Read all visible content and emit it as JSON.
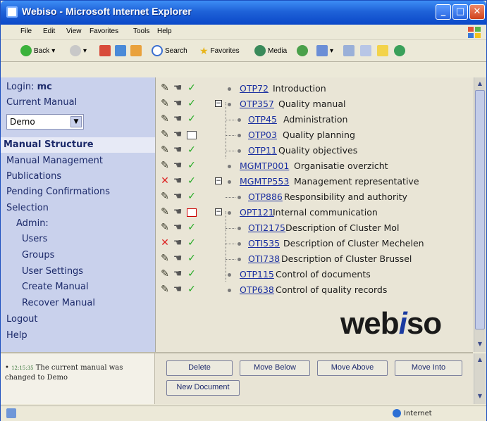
{
  "window": {
    "title": "Webiso - Microsoft Internet Explorer"
  },
  "menu": [
    "File",
    "Edit",
    "View",
    "Favorites",
    "Tools",
    "Help"
  ],
  "toolbar": {
    "back": "Back",
    "search": "Search",
    "favorites": "Favorites",
    "media": "Media"
  },
  "sidebar": {
    "login_label": "Login:",
    "login_user": "mc",
    "current_manual_label": "Current Manual",
    "current_manual_value": "Demo",
    "items": [
      "Manual Structure",
      "Manual Management",
      "Publications",
      "Pending Confirmations",
      "Selection",
      "Admin:",
      "Users",
      "Groups",
      "User Settings",
      "Create Manual",
      "Recover Manual",
      "Logout",
      "Help"
    ]
  },
  "tree": [
    {
      "code": "OTP72",
      "title": "Introduction"
    },
    {
      "code": "OTP357",
      "title": "Quality manual"
    },
    {
      "code": "OTP45",
      "title": "Administration"
    },
    {
      "code": "OTP03",
      "title": "Quality planning"
    },
    {
      "code": "OTP11",
      "title": "Quality objectives"
    },
    {
      "code": "MGMTP001",
      "title": "Organisatie overzicht"
    },
    {
      "code": "MGMTP553",
      "title": "Management representative"
    },
    {
      "code": "OTP886",
      "title": "Responsibility and authority"
    },
    {
      "code": "OPT121",
      "title": "Internal communication"
    },
    {
      "code": "OTI2175",
      "title": "Description of Cluster Mol"
    },
    {
      "code": "OTI535",
      "title": "Description of Cluster Mechelen"
    },
    {
      "code": "OTI738",
      "title": "Description of Cluster Brussel"
    },
    {
      "code": "OTP115",
      "title": "Control of documents"
    },
    {
      "code": "OTP638",
      "title": "Control of quality records"
    }
  ],
  "logo": {
    "pre": "web",
    "mid": "i",
    "post": "so"
  },
  "message": {
    "tag": "12:15:35",
    "text": "The current manual was changed to Demo"
  },
  "buttons": {
    "delete": "Delete",
    "move_below": "Move Below",
    "move_above": "Move Above",
    "move_into": "Move Into",
    "new_document": "New Document"
  },
  "statusbar": {
    "zone": "Internet"
  }
}
